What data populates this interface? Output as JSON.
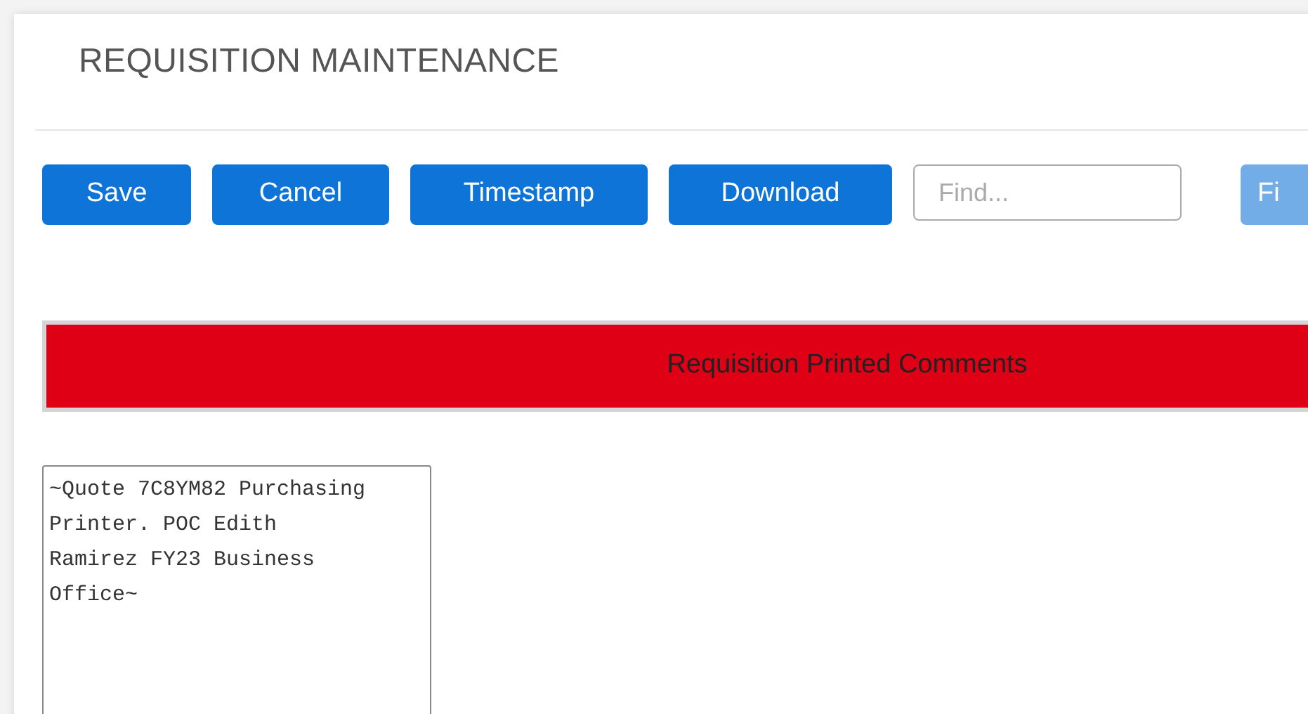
{
  "title": "REQUISITION MAINTENANCE",
  "toolbar": {
    "buttons": [
      {
        "label": "Save",
        "disabled": false
      },
      {
        "label": "Cancel",
        "disabled": false
      },
      {
        "label": "Timestamp",
        "disabled": false
      },
      {
        "label": "Download",
        "disabled": false
      }
    ],
    "search": {
      "placeholder": "Find..."
    },
    "find_button": {
      "label": "Fi",
      "disabled": true
    }
  },
  "section": {
    "title": "Requisition Printed Comments"
  },
  "comments": {
    "value": "~Quote 7C8YM82 Purchasing Printer. POC Edith Ramirez FY23 Business Office~"
  }
}
